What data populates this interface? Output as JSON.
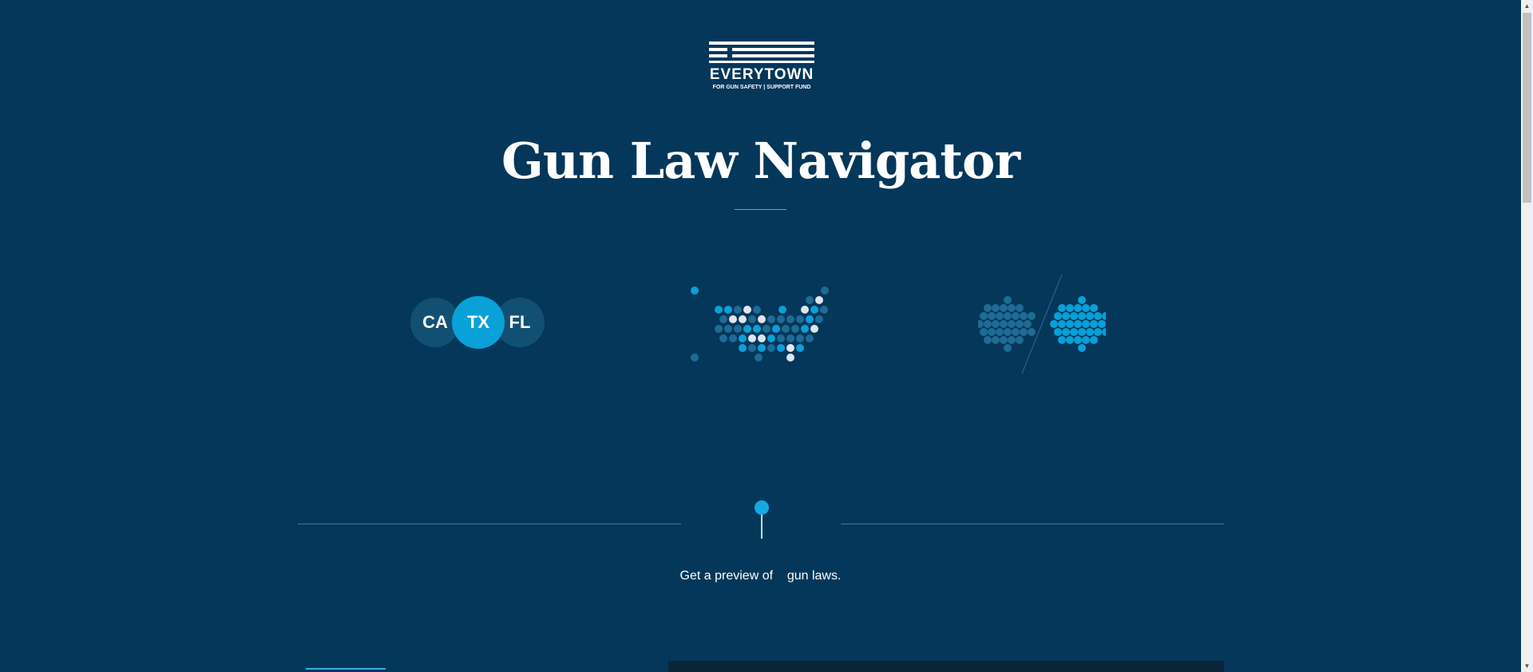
{
  "logo": {
    "wordmark": "EVERYTOWN",
    "tagline": "FOR GUN SAFETY | SUPPORT FUND"
  },
  "page_title": "Gun Law Navigator",
  "feature_icons": {
    "state_comparison": {
      "states": [
        "CA",
        "TX",
        "FL"
      ],
      "highlighted": "TX"
    },
    "us_map_icon": "us-dot-map-icon",
    "split_comparison_icon": "dot-split-comparison-icon"
  },
  "caption": {
    "prefix": "Get a preview of ",
    "suffix": " gun laws."
  },
  "scrollbar": {
    "up_arrow": "▲",
    "down_arrow": "▼"
  },
  "colors": {
    "background": "#05375a",
    "accent": "#0aa0d8",
    "dark_circle": "#125073",
    "muted_dot": "#1e6b95",
    "light_dot": "#dde6ee"
  }
}
